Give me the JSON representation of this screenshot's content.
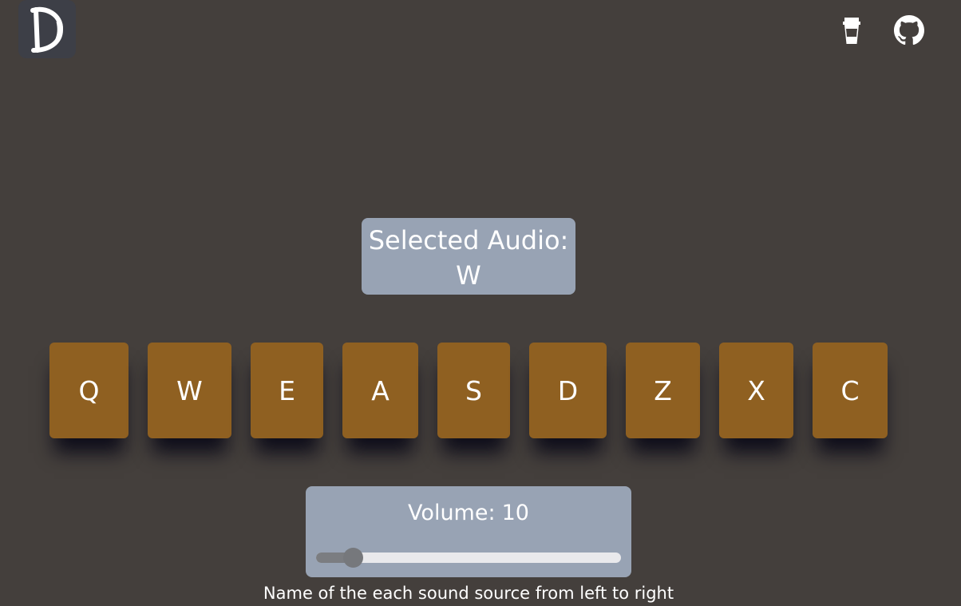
{
  "header": {
    "logo_icon": "brush-letter-d-logo",
    "actions": [
      {
        "icon": "coffee-cup-icon"
      },
      {
        "icon": "github-icon"
      }
    ]
  },
  "selected_audio": {
    "label": "Selected Audio:",
    "value": "W"
  },
  "pads": [
    {
      "key": "Q"
    },
    {
      "key": "W"
    },
    {
      "key": "E"
    },
    {
      "key": "A"
    },
    {
      "key": "S"
    },
    {
      "key": "D"
    },
    {
      "key": "Z"
    },
    {
      "key": "X"
    },
    {
      "key": "C"
    }
  ],
  "volume": {
    "label": "Volume:",
    "value": "10",
    "fraction": 0.12
  },
  "caption": "Name of the each sound source from left to right",
  "colors": {
    "background": "#443f3c",
    "pad": "#8f6021",
    "panel": "#98a3b4",
    "logo_tile": "#3d3f47"
  }
}
